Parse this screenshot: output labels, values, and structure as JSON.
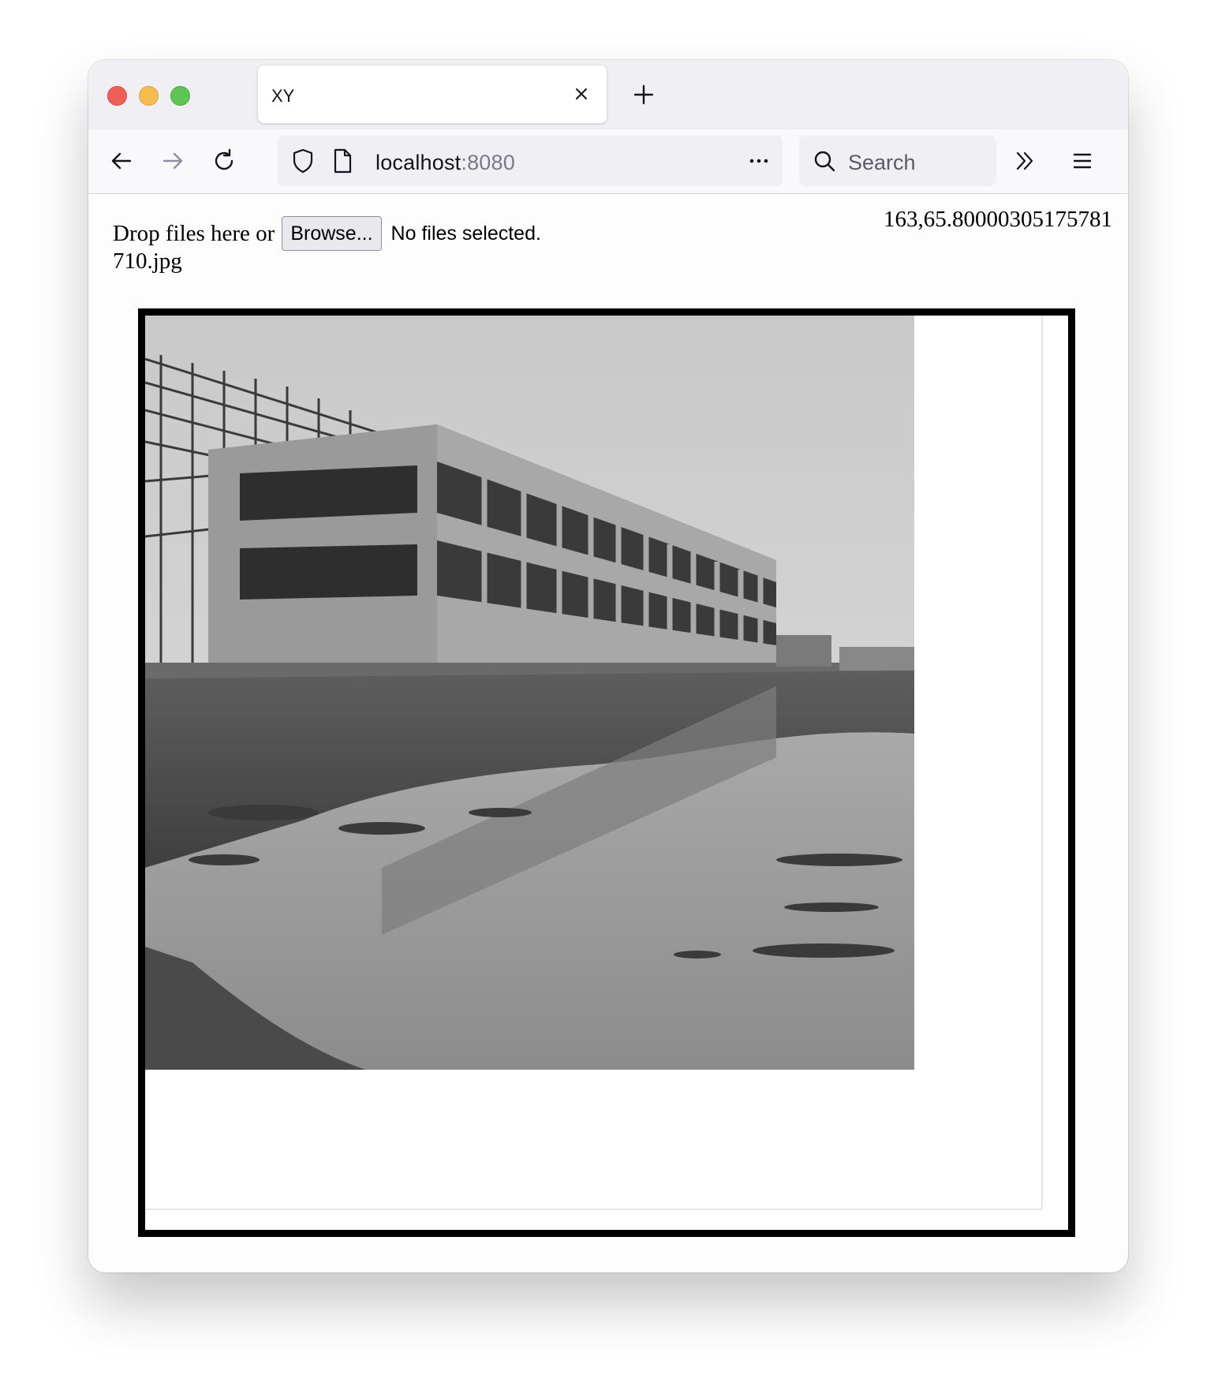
{
  "browser": {
    "tab": {
      "title": "XY"
    },
    "url": {
      "host": "localhost",
      "port": ":8080"
    },
    "search": {
      "placeholder": "Search"
    }
  },
  "page": {
    "drop_text": "Drop files here or",
    "browse_label": "Browse...",
    "file_status": "No files selected.",
    "filename": "710.jpg",
    "coordinates": "163,65.80000305175781"
  },
  "colors": {
    "traffic_red": "#ee5f57",
    "traffic_yellow": "#f5bd4f",
    "traffic_green": "#5fc454"
  }
}
